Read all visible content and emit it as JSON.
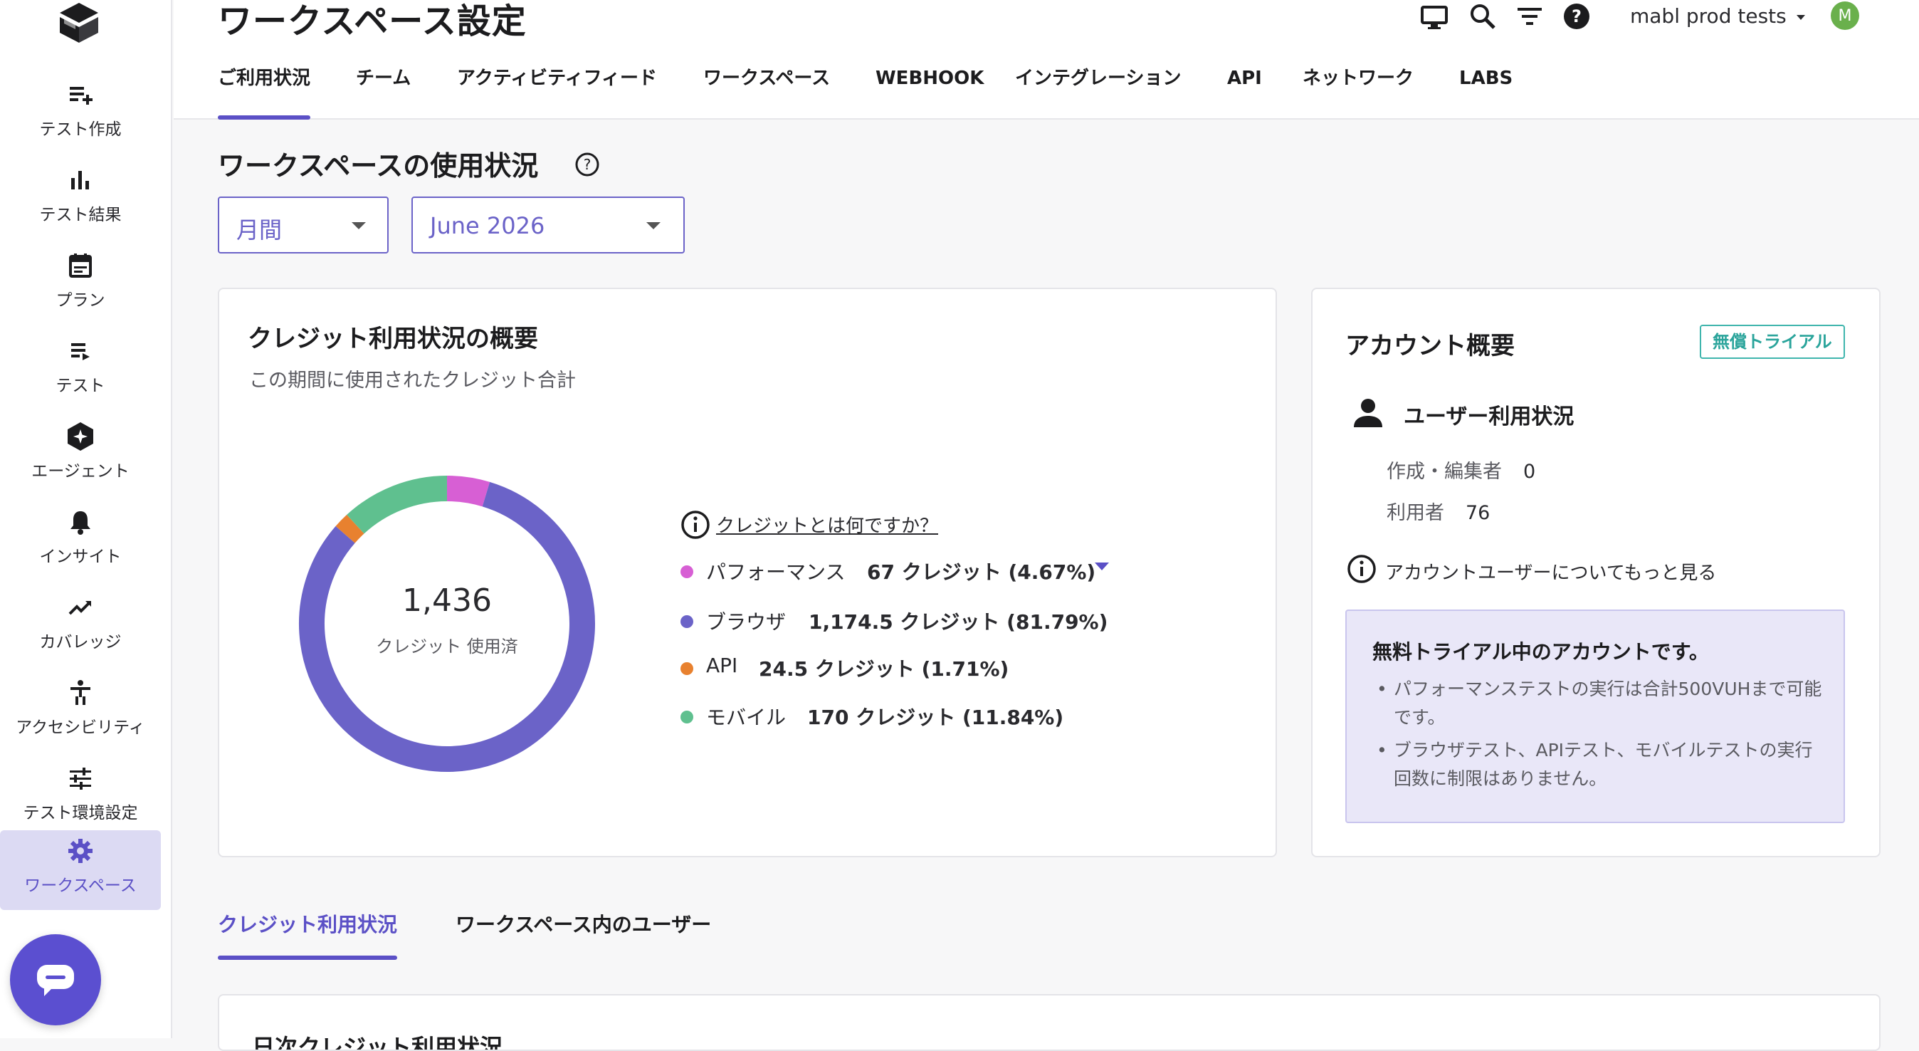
{
  "sidebar": {
    "items": [
      {
        "label": "テスト作成",
        "icon": "add-list-icon"
      },
      {
        "label": "テスト結果",
        "icon": "bar-chart-icon"
      },
      {
        "label": "プラン",
        "icon": "calendar-icon"
      },
      {
        "label": "テスト",
        "icon": "list-play-icon"
      },
      {
        "label": "エージェント",
        "icon": "agent-hexagon-icon"
      },
      {
        "label": "インサイト",
        "icon": "bell-icon"
      },
      {
        "label": "カバレッジ",
        "icon": "trending-up-icon"
      },
      {
        "label": "アクセシビリティ",
        "icon": "accessibility-icon"
      },
      {
        "label": "テスト環境設定",
        "icon": "sliders-icon"
      },
      {
        "label": "ワークスペース",
        "icon": "gear-icon"
      }
    ],
    "active_index": 9
  },
  "header": {
    "title": "ワークスペース設定",
    "workspace_name": "mabl prod tests",
    "avatar_initial": "M",
    "tabs": [
      "ご利用状況",
      "チーム",
      "アクティビティフィード",
      "ワークスペース",
      "WEBHOOK",
      "インテグレーション",
      "API",
      "ネットワーク",
      "LABS"
    ],
    "active_tab": 0
  },
  "usage": {
    "section_title": "ワークスペースの使用状況",
    "period_select": "月間",
    "month_select": "June 2026"
  },
  "credits_card": {
    "title": "クレジット利用状況の概要",
    "subtitle": "この期間に使用されたクレジット合計",
    "total": "1,436",
    "total_label": "クレジット 使用済",
    "what_is_credit": "クレジットとは何ですか？"
  },
  "chart_data": {
    "type": "pie",
    "categories": [
      "パフォーマンス",
      "ブラウザ",
      "API",
      "モバイル"
    ],
    "values": [
      67,
      1174.5,
      24.5,
      170
    ],
    "value_labels": [
      "67 クレジット (4.67%)",
      "1,174.5 クレジット (81.79%)",
      "24.5 クレジット (1.71%)",
      "170 クレジット (11.84%)"
    ],
    "colors": [
      "#d75fd4",
      "#6b63c8",
      "#e8812f",
      "#5fc08f"
    ]
  },
  "account_card": {
    "title": "アカウント概要",
    "badge": "無償トライアル",
    "user_stats_title": "ユーザー利用状況",
    "editors_label": "作成・編集者",
    "editors_value": "0",
    "users_label": "利用者",
    "users_value": "76",
    "learn_more": "アカウントユーザーについてもっと見る",
    "trial_title": "無料トライアル中のアカウントです。",
    "trial_points": [
      "パフォーマンステストの実行は合計500VUHまで可能です。",
      "ブラウザテスト、APIテスト、モバイルテストの実行回数に制限はありません。"
    ]
  },
  "subtabs": [
    "クレジット利用状況",
    "ワークスペース内のユーザー"
  ],
  "bottom_card_title": "日次クレジット利用状況",
  "colors": {
    "accent": "#5b50c6",
    "teal": "#3fb5ad"
  }
}
